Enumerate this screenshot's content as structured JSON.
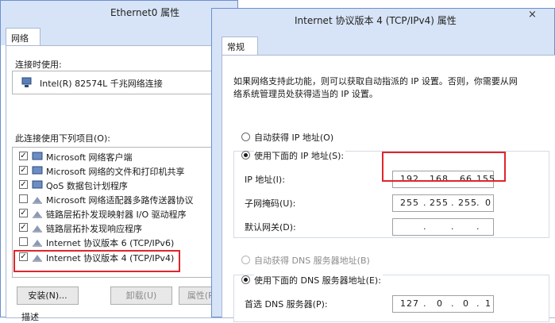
{
  "back_window": {
    "title": "Ethernet0 属性",
    "tab": "网络",
    "connect_using_label": "连接时使用:",
    "adapter": "Intel(R) 82574L 千兆网络连接",
    "items_label": "此连接使用下列项目(O):",
    "items": [
      {
        "label": "Microsoft 网络客户端",
        "checked": true
      },
      {
        "label": "Microsoft 网络的文件和打印机共享",
        "checked": true
      },
      {
        "label": "QoS 数据包计划程序",
        "checked": true
      },
      {
        "label": "Microsoft 网络适配器多路传送器协议",
        "checked": false
      },
      {
        "label": "链路层拓扑发现映射器 I/O 驱动程序",
        "checked": true
      },
      {
        "label": "链路层拓扑发现响应程序",
        "checked": true
      },
      {
        "label": "Internet 协议版本 6 (TCP/IPv6)",
        "checked": true
      },
      {
        "label": "Internet 协议版本 4 (TCP/IPv4)",
        "checked": true
      }
    ],
    "buttons": {
      "install": "安装(N)...",
      "uninstall": "卸载(U)",
      "properties": "属性(R)"
    },
    "description_label": "描述"
  },
  "front_window": {
    "title": "Internet 协议版本 4 (TCP/IPv4) 属性",
    "close_glyph": "×",
    "tab": "常规",
    "info_line1": "如果网络支持此功能，则可以获取自动指派的 IP 设置。否则，你需要从网",
    "info_line2": "络系统管理员处获得适当的 IP 设置。",
    "ip_auto_label": "自动获得 IP 地址(O)",
    "ip_manual_label": "使用下面的 IP 地址(S):",
    "ip_address_label": "IP 地址(I):",
    "ip_address": [
      "192",
      "168",
      "66",
      "155"
    ],
    "subnet_label": "子网掩码(U):",
    "subnet": [
      "255",
      "255",
      "255",
      "0"
    ],
    "gateway_label": "默认网关(D):",
    "gateway": [
      "",
      "",
      "",
      ""
    ],
    "dns_auto_label": "自动获得 DNS 服务器地址(B)",
    "dns_manual_label": "使用下面的 DNS 服务器地址(E):",
    "dns_preferred_label": "首选 DNS 服务器(P):",
    "dns_preferred": [
      "127",
      "0",
      "0",
      "1"
    ]
  },
  "colors": {
    "highlight": "#e0252b",
    "titlebar": "#d7e4f7",
    "border": "#6b8fcf"
  }
}
